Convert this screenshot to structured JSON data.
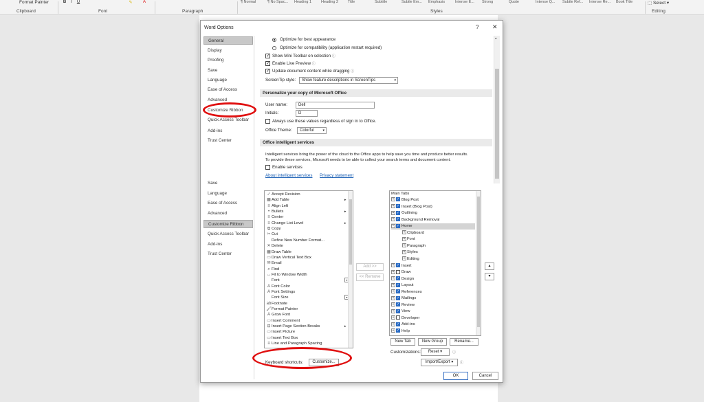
{
  "ribbon": {
    "format_painter": "Format Painter",
    "clipboard": "Clipboard",
    "font": "Font",
    "paragraph": "Paragraph",
    "styles": "Styles",
    "editing": "Editing",
    "select": "Select",
    "style_items": [
      "¶ Normal",
      "¶ No Spac...",
      "Heading 1",
      "Heading 2",
      "Title",
      "Subtitle",
      "Subtle Em...",
      "Emphasis",
      "Intense E...",
      "Strong",
      "Quote",
      "Intense Q...",
      "Subtle Ref...",
      "Intense Re...",
      "Book Title"
    ]
  },
  "dialog": {
    "title": "Word Options",
    "help": "?",
    "close": "✕",
    "ok": "OK",
    "cancel": "Cancel"
  },
  "nav_top": [
    "General",
    "Display",
    "Proofing",
    "Save",
    "Language",
    "Ease of Access",
    "Advanced",
    "Customize Ribbon",
    "Quick Access Toolbar",
    "Add-ins",
    "Trust Center"
  ],
  "nav_bottom": [
    "Save",
    "Language",
    "Ease of Access",
    "Advanced",
    "Customize Ribbon",
    "Quick Access Toolbar",
    "Add-ins",
    "Trust Center"
  ],
  "general": {
    "opt_best_appearance": "Optimize for best appearance",
    "opt_compat": "Optimize for compatibility (application restart required)",
    "mini_toolbar": "Show Mini Toolbar on selection",
    "live_preview": "Enable Live Preview",
    "update_dragging": "Update document content while dragging",
    "screentip_label": "ScreenTip style:",
    "screentip_value": "Show feature descriptions in ScreenTips",
    "personalize_header": "Personalize your copy of Microsoft Office",
    "user_name_label": "User name:",
    "user_name_value": "Dell",
    "initials_label": "Initials:",
    "initials_value": "D",
    "always_use": "Always use these values regardless of sign in to Office.",
    "theme_label": "Office Theme:",
    "theme_value": "Colorful",
    "intelligent_header": "Office intelligent services",
    "intelligent_desc_1": "Intelligent services bring the power of the cloud to the Office apps to help save you time and produce better results.",
    "intelligent_desc_2": "To provide these services, Microsoft needs to be able to collect your search terms and document content.",
    "enable_services": "Enable services",
    "about_link": "About intelligent services",
    "privacy_link": "Privacy statement"
  },
  "commands_list": [
    "Accept Revision",
    "Add Table",
    "Align Left",
    "Bullets",
    "Center",
    "Change List Level",
    "Copy",
    "Cut",
    "Define New Number Format...",
    "Delete",
    "Draw Table",
    "Draw Vertical Text Box",
    "Email",
    "Find",
    "Fit to Window Width",
    "Font",
    "Font Color",
    "Font Settings",
    "Font Size",
    "Footnote",
    "Format Painter",
    "Grow Font",
    "Insert Comment",
    "Insert Page Section Breaks",
    "Insert Picture",
    "Insert Text Box",
    "Line and Paragraph Spacing"
  ],
  "tabs_tree": {
    "header": "Main Tabs",
    "items": [
      {
        "label": "Blog Post",
        "checked": true,
        "level": 1
      },
      {
        "label": "Insert (Blog Post)",
        "checked": true,
        "level": 1
      },
      {
        "label": "Outlining",
        "checked": true,
        "level": 1
      },
      {
        "label": "Background Removal",
        "checked": true,
        "level": 1
      },
      {
        "label": "Home",
        "checked": true,
        "level": 1,
        "expanded": true,
        "selected": true
      },
      {
        "label": "Clipboard",
        "level": 2
      },
      {
        "label": "Font",
        "level": 2
      },
      {
        "label": "Paragraph",
        "level": 2
      },
      {
        "label": "Styles",
        "level": 2
      },
      {
        "label": "Editing",
        "level": 2
      },
      {
        "label": "Insert",
        "checked": true,
        "level": 1
      },
      {
        "label": "Draw",
        "checked": false,
        "level": 1
      },
      {
        "label": "Design",
        "checked": true,
        "level": 1
      },
      {
        "label": "Layout",
        "checked": true,
        "level": 1
      },
      {
        "label": "References",
        "checked": true,
        "level": 1
      },
      {
        "label": "Mailings",
        "checked": true,
        "level": 1
      },
      {
        "label": "Review",
        "checked": true,
        "level": 1
      },
      {
        "label": "View",
        "checked": true,
        "level": 1
      },
      {
        "label": "Developer",
        "checked": false,
        "level": 1
      },
      {
        "label": "Add-ins",
        "checked": true,
        "level": 1
      },
      {
        "label": "Help",
        "checked": true,
        "level": 1
      }
    ]
  },
  "customize": {
    "add": "Add >>",
    "remove": "<< Remove",
    "new_tab": "New Tab",
    "new_group": "New Group",
    "rename": "Rename...",
    "customizations_label": "Customizations:",
    "reset": "Reset ▾",
    "import_export": "Import/Export ▾",
    "keyboard_label": "Keyboard shortcuts:",
    "customize_btn": "Customize..."
  },
  "colors": {
    "annotation_red": "#e01010",
    "checkbox_blue": "#2b6cc4"
  }
}
